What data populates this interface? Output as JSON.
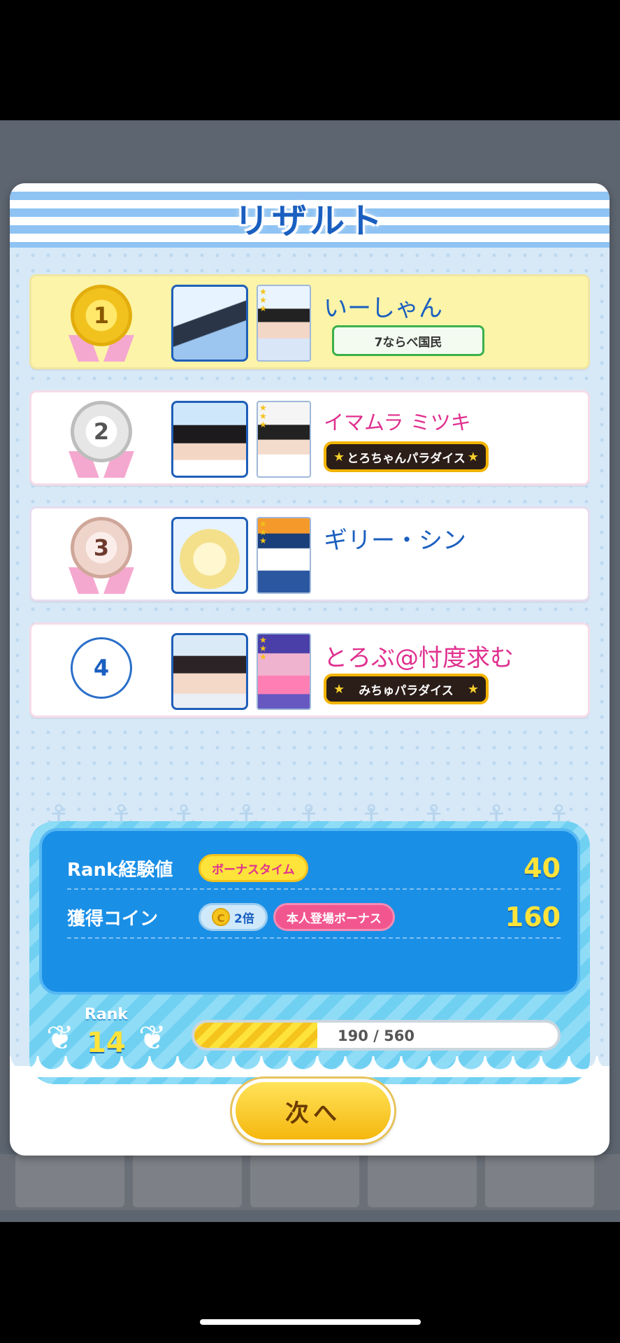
{
  "modal": {
    "title": "リザルト"
  },
  "ranking": [
    {
      "rank": "1",
      "name": "いーしゃん",
      "badge": "7ならべ国民"
    },
    {
      "rank": "2",
      "name": "イマムラ ミツキ",
      "badge": "とろちゃんパラダイス"
    },
    {
      "rank": "3",
      "name": "ギリー・シン",
      "badge": ""
    },
    {
      "rank": "4",
      "name": "とろぶ@忖度求む",
      "badge": "みちゅパラダイス"
    }
  ],
  "summary": {
    "exp_label": "Rank経験値",
    "exp_bonus": "ボーナスタイム",
    "exp_value": "40",
    "coin_label": "獲得コイン",
    "coin_multiplier": "2倍",
    "coin_icon_letter": "C",
    "coin_bonus": "本人登場ボーナス",
    "coin_value": "160"
  },
  "rank_info": {
    "label": "Rank",
    "level": "14",
    "progress_text": "190 / 560",
    "progress_current": 190,
    "progress_max": 560
  },
  "buttons": {
    "next": "次へ"
  },
  "icons": [
    "medal-gold-icon",
    "medal-silver-icon",
    "medal-bronze-icon",
    "laurel-icon",
    "coin-icon",
    "star-icon"
  ],
  "colors": {
    "accent": "#1a5fc0",
    "highlight": "#fcf4a8",
    "button": "#f5b70e",
    "value": "#fde33a"
  }
}
